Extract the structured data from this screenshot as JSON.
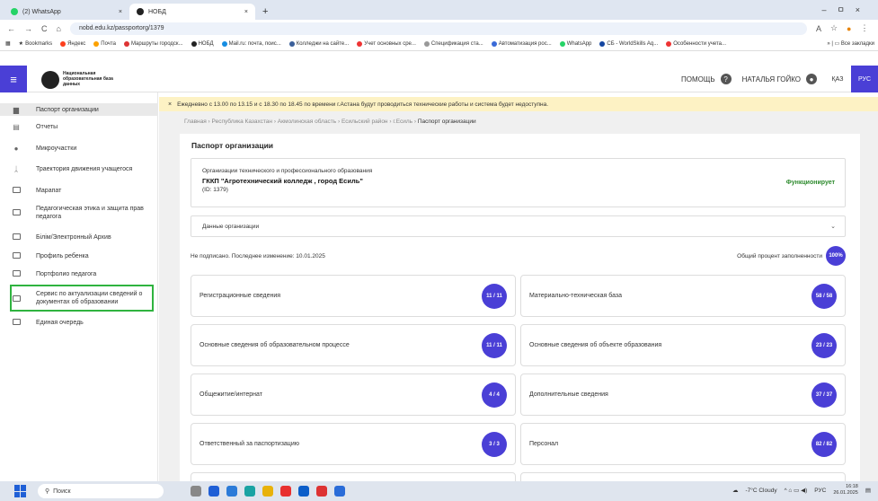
{
  "browser": {
    "tabs": [
      {
        "title": "(2) WhatsApp",
        "color": "#25d366"
      },
      {
        "title": "НОБД",
        "color": "#222222"
      }
    ],
    "url": "nobd.edu.kz/passportorg/1379",
    "bookmarks": [
      "Bookmarks",
      "Яндекс",
      "Почта",
      "Маршруты городск...",
      "НОБД",
      "Mail.ru: почта, поис...",
      "Колледжи на сайте...",
      "Учет основных сре...",
      "Спецификация ста...",
      "Автоматизация рос...",
      "WhatsApp",
      "СБ - WorldSkills Aq...",
      "Особенности учета..."
    ],
    "bookmarks_right": "Все закладки"
  },
  "header": {
    "logo_text": "Национальная образовательная база данных",
    "help": "ПОМОЩЬ",
    "user": "НАТАЛЬЯ ГОЙКО",
    "lang_kz": "ҚАЗ",
    "lang_ru": "РУС"
  },
  "sidebar": {
    "items": [
      {
        "label": "Паспорт организации",
        "icon": "passport-icon"
      },
      {
        "label": "Отчеты",
        "icon": "report-icon"
      },
      {
        "label": "Микроучастки",
        "icon": "location-pin-icon"
      },
      {
        "label": "Траектория движения учащегося",
        "icon": "walker-icon"
      },
      {
        "label": "Марапат",
        "icon": "folder-icon"
      },
      {
        "label": "Педагогическая этика и защита прав педагога",
        "icon": "folder-icon"
      },
      {
        "label": "Білім/Электронный Архив",
        "icon": "folder-icon"
      },
      {
        "label": "Профиль ребенка",
        "icon": "folder-icon"
      },
      {
        "label": "Портфолио педагога",
        "icon": "folder-icon"
      },
      {
        "label": "Сервис по актуализации сведений о документах об образовании",
        "icon": "folder-icon"
      },
      {
        "label": "Единая очередь",
        "icon": "folder-icon"
      }
    ]
  },
  "notice": "Ежедневно с 13.00 по 13.15 и с 18.30 по 18.45 по времени г.Астана будут проводиться технические работы и система будет недоступна.",
  "breadcrumb": [
    "Главная",
    "Республика Казахстан",
    "Акмолинская область",
    "Есильский район",
    "г.Есиль",
    "Паспорт организации"
  ],
  "card": {
    "title": "Паспорт организации",
    "org_type": "Организации технического и профессионального образования",
    "org_name": "ГККП \"Агротехнический колледж , город Есиль\"",
    "org_id": "(ID: 1379)",
    "status": "Функционирует",
    "data_label": "Данные организации",
    "sign_status": "Не подписано. Последнее изменение: 10.01.2025",
    "fill_label": "Общий процент заполненности",
    "fill_value": "100%"
  },
  "sections": [
    {
      "label": "Регистрационные сведения",
      "badge": "11 / 11"
    },
    {
      "label": "Материально-техническая база",
      "badge": "58 / 58"
    },
    {
      "label": "Основные сведения об образовательном процессе",
      "badge": "11 / 11"
    },
    {
      "label": "Основные сведения об объекте образования",
      "badge": "23 / 23"
    },
    {
      "label": "Общежитие/интернат",
      "badge": "4 / 4"
    },
    {
      "label": "Дополнительные сведения",
      "badge": "37 / 37"
    },
    {
      "label": "Ответственный за паспортизацию",
      "badge": "3 / 3"
    },
    {
      "label": "Персонал",
      "badge": "82 / 82"
    }
  ],
  "taskbar": {
    "search": "Поиск",
    "weather": "-7°C Cloudy",
    "lang": "РУС",
    "time": "16:18",
    "date": "26.01.2025"
  },
  "colors": {
    "accent": "#4a3fd6",
    "status_ok": "#2d8a2d",
    "highlight": "#2fb33f",
    "notice": "#fdf2c4"
  }
}
